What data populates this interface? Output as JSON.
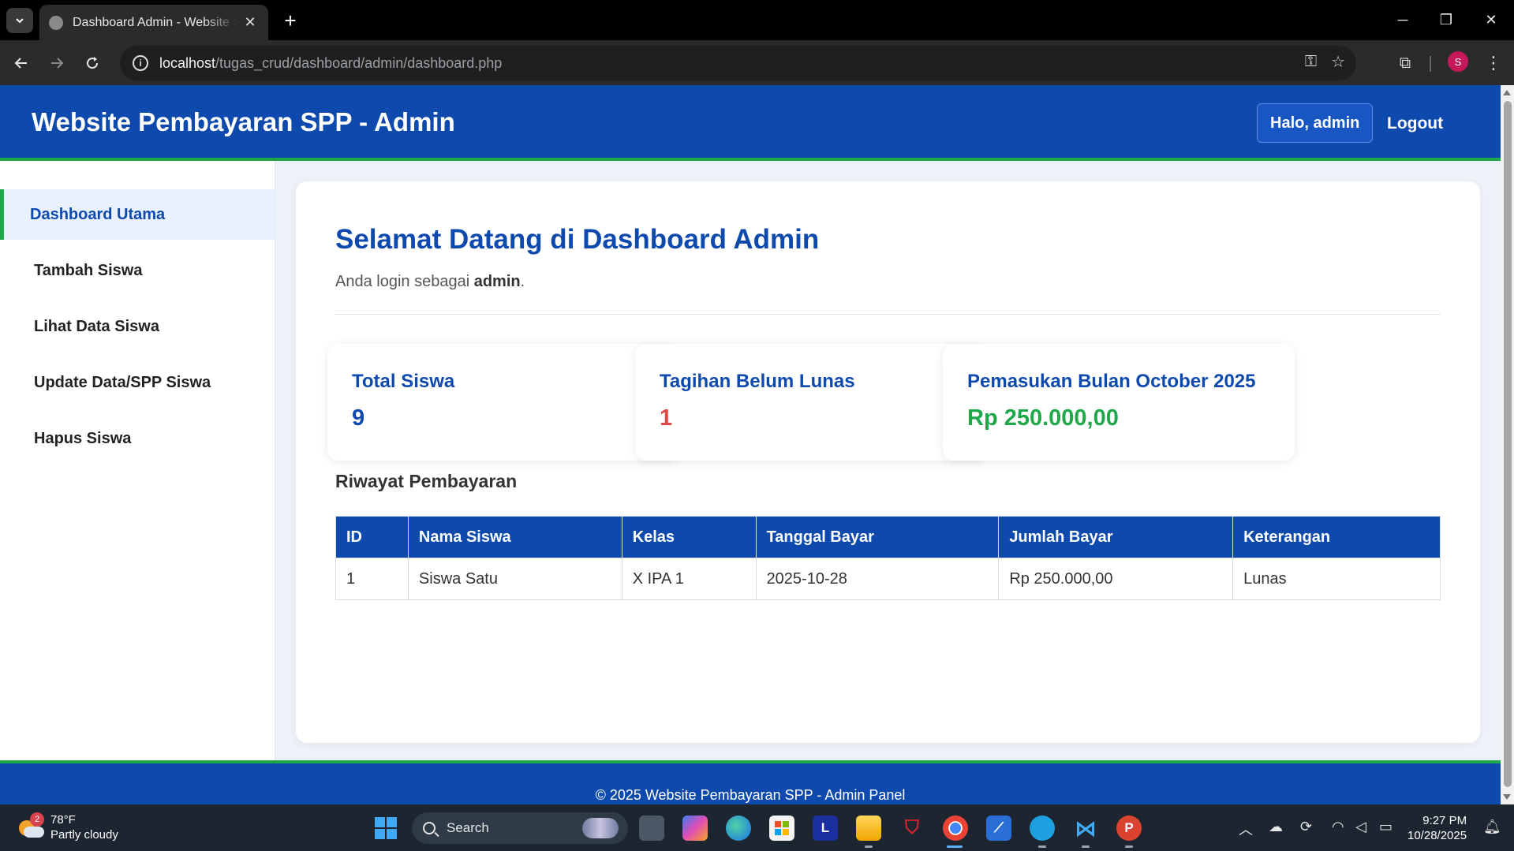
{
  "browser": {
    "tab_title": "Dashboard Admin - Website SPP",
    "url_host": "localhost",
    "url_path": "/tugas_crud/dashboard/admin/dashboard.php",
    "profile_initial": "S"
  },
  "header": {
    "title": "Website Pembayaran SPP - Admin",
    "greeting": "Halo, admin",
    "logout": "Logout"
  },
  "sidebar": {
    "items": [
      {
        "label": "Dashboard Utama",
        "active": true
      },
      {
        "label": "Tambah Siswa",
        "active": false
      },
      {
        "label": "Lihat Data Siswa",
        "active": false
      },
      {
        "label": "Update Data/SPP Siswa",
        "active": false
      },
      {
        "label": "Hapus Siswa",
        "active": false
      }
    ]
  },
  "main": {
    "welcome": "Selamat Datang di Dashboard Admin",
    "login_prefix": "Anda login sebagai",
    "login_user": "admin",
    "login_suffix": ".",
    "stats": [
      {
        "label": "Total Siswa",
        "value": "9",
        "color": "#0e4aae"
      },
      {
        "label": "Tagihan Belum Lunas",
        "value": "1",
        "color": "#e04646"
      },
      {
        "label": "Pemasukan Bulan October 2025",
        "value": "Rp 250.000,00",
        "color": "#1fa84a"
      }
    ],
    "history_title": "Riwayat Pembayaran",
    "table": {
      "headers": [
        "ID",
        "Nama Siswa",
        "Kelas",
        "Tanggal Bayar",
        "Jumlah Bayar",
        "Keterangan"
      ],
      "rows": [
        [
          "1",
          "Siswa Satu",
          "X IPA 1",
          "2025-10-28",
          "Rp 250.000,00",
          "Lunas"
        ]
      ]
    }
  },
  "footer": {
    "text": "© 2025 Website Pembayaran SPP - Admin Panel"
  },
  "taskbar": {
    "weather_badge": "2",
    "temperature": "78°F",
    "condition": "Partly cloudy",
    "search_label": "Search",
    "time": "9:27 PM",
    "date": "10/28/2025"
  },
  "colors": {
    "primary": "#0e4aae",
    "accent_green": "#1fa84a",
    "danger": "#e04646"
  }
}
